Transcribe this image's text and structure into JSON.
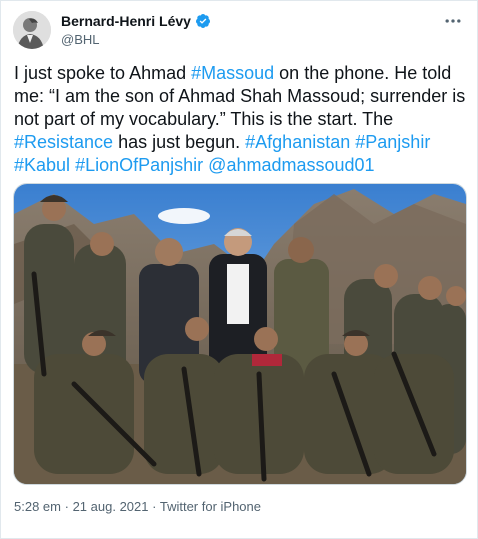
{
  "author": {
    "display_name": "Bernard-Henri Lévy",
    "handle": "@BHL",
    "verified_icon": "verified-badge-icon",
    "avatar_icon": "profile-avatar"
  },
  "more_icon": "more-horizontal-icon",
  "tweet": {
    "parts": [
      {
        "type": "text",
        "value": "I just spoke to Ahmad "
      },
      {
        "type": "link",
        "value": "#Massoud"
      },
      {
        "type": "text",
        "value": " on the phone. He told me: “I am the son of Ahmad Shah Massoud; surrender is not part of my vocabulary.” This is the start. The "
      },
      {
        "type": "link",
        "value": "#Resistance"
      },
      {
        "type": "text",
        "value": " has just begun. "
      },
      {
        "type": "link",
        "value": "#Afghanistan"
      },
      {
        "type": "text",
        "value": " "
      },
      {
        "type": "link",
        "value": "#Panjshir"
      },
      {
        "type": "text",
        "value": " "
      },
      {
        "type": "link",
        "value": "#Kabul"
      },
      {
        "type": "text",
        "value": " "
      },
      {
        "type": "link",
        "value": "#LionOfPanjshir"
      },
      {
        "type": "text",
        "value": " "
      },
      {
        "type": "link",
        "value": "@ahmadmassoud01"
      }
    ]
  },
  "media": {
    "kind": "photo",
    "subject": "group-photo"
  },
  "meta": {
    "time": "5:28 em",
    "separator": "·",
    "date": "21 aug. 2021",
    "source": "Twitter for iPhone"
  },
  "colors": {
    "link": "#1d9bf0",
    "text": "#0f1419",
    "secondary": "#536471",
    "border": "#cfd9de"
  }
}
